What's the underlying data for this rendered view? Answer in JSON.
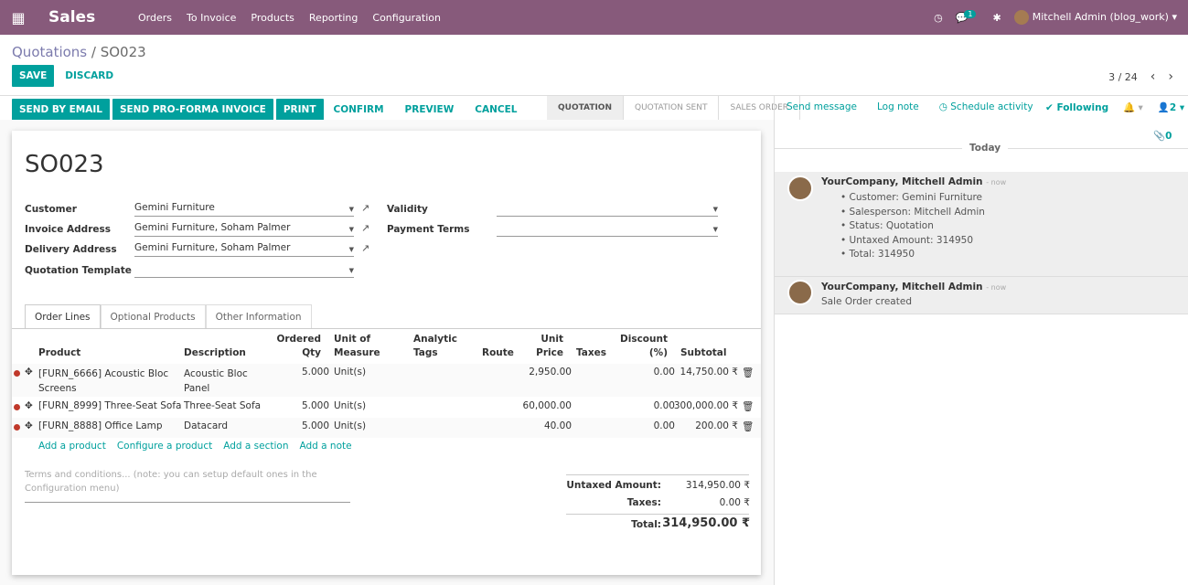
{
  "app": {
    "name": "Sales",
    "menu": [
      "Orders",
      "To Invoice",
      "Products",
      "Reporting",
      "Configuration"
    ],
    "user": "Mitchell Admin (blog_work)",
    "chat_badge": "1"
  },
  "breadcrumb": {
    "parent": "Quotations",
    "sep": " / ",
    "current": "SO023"
  },
  "actions": {
    "save": "SAVE",
    "discard": "DISCARD"
  },
  "pager": {
    "value": "3 / 24"
  },
  "status_buttons": [
    "SEND BY EMAIL",
    "SEND PRO-FORMA INVOICE",
    "PRINT",
    "CONFIRM",
    "PREVIEW",
    "CANCEL"
  ],
  "stages": [
    "QUOTATION",
    "QUOTATION SENT",
    "SALES ORDER"
  ],
  "form": {
    "name": "SO023",
    "left": [
      {
        "label": "Customer",
        "value": "Gemini Furniture"
      },
      {
        "label": "Invoice Address",
        "value": "Gemini Furniture, Soham Palmer"
      },
      {
        "label": "Delivery Address",
        "value": "Gemini Furniture, Soham Palmer"
      },
      {
        "label": "Quotation Template",
        "value": ""
      }
    ],
    "right": [
      {
        "label": "Validity",
        "value": ""
      },
      {
        "label": "Payment Terms",
        "value": ""
      }
    ]
  },
  "tabs": [
    "Order Lines",
    "Optional Products",
    "Other Information"
  ],
  "table": {
    "headers": {
      "product": "Product",
      "description": "Description",
      "qty1": "Ordered",
      "qty2": "Qty",
      "uom1": "Unit of",
      "uom2": "Measure",
      "tags1": "Analytic",
      "tags2": "Tags",
      "route": "Route",
      "price1": "Unit",
      "price2": "Price",
      "taxes": "Taxes",
      "disc1": "Discount",
      "disc2": "(%)",
      "subtotal": "Subtotal"
    },
    "rows": [
      {
        "product1": "[FURN_6666] Acoustic Bloc",
        "product2": "Screens",
        "desc1": "Acoustic Bloc",
        "desc2": "Panel",
        "qty": "5.000",
        "uom": "Unit(s)",
        "price": "2,950.00",
        "disc": "0.00",
        "subtotal": "14,750.00 ₹"
      },
      {
        "product1": "[FURN_8999] Three-Seat Sofa",
        "product2": "",
        "desc1": "Three-Seat Sofa",
        "desc2": "",
        "qty": "5.000",
        "uom": "Unit(s)",
        "price": "60,000.00",
        "disc": "0.00",
        "subtotal": "300,000.00 ₹"
      },
      {
        "product1": "[FURN_8888] Office Lamp",
        "product2": "",
        "desc1": "Datacard",
        "desc2": "",
        "qty": "5.000",
        "uom": "Unit(s)",
        "price": "40.00",
        "disc": "0.00",
        "subtotal": "200.00 ₹"
      }
    ]
  },
  "add_links": [
    "Add a product",
    "Configure a product",
    "Add a section",
    "Add a note"
  ],
  "terms": "Terms and conditions... (note: you can setup default ones in the Configuration menu)",
  "totals": {
    "untaxed_label": "Untaxed Amount:",
    "untaxed": "314,950.00 ₹",
    "taxes_label": "Taxes:",
    "taxes": "0.00 ₹",
    "total_label": "Total:",
    "total": "314,950.00 ₹"
  },
  "chatter": {
    "send": "Send message",
    "log": "Log note",
    "schedule": "Schedule activity",
    "following": "Following",
    "followers": "2",
    "attachments": "0",
    "day": "Today",
    "messages": [
      {
        "author": "YourCompany, Mitchell Admin",
        "time": "- now",
        "lines": [
          "Customer: Gemini Furniture",
          "Salesperson: Mitchell Admin",
          "Status: Quotation",
          "Untaxed Amount: 314950",
          "Total: 314950"
        ]
      },
      {
        "author": "YourCompany, Mitchell Admin",
        "time": "- now",
        "body": "Sale Order created"
      }
    ]
  }
}
